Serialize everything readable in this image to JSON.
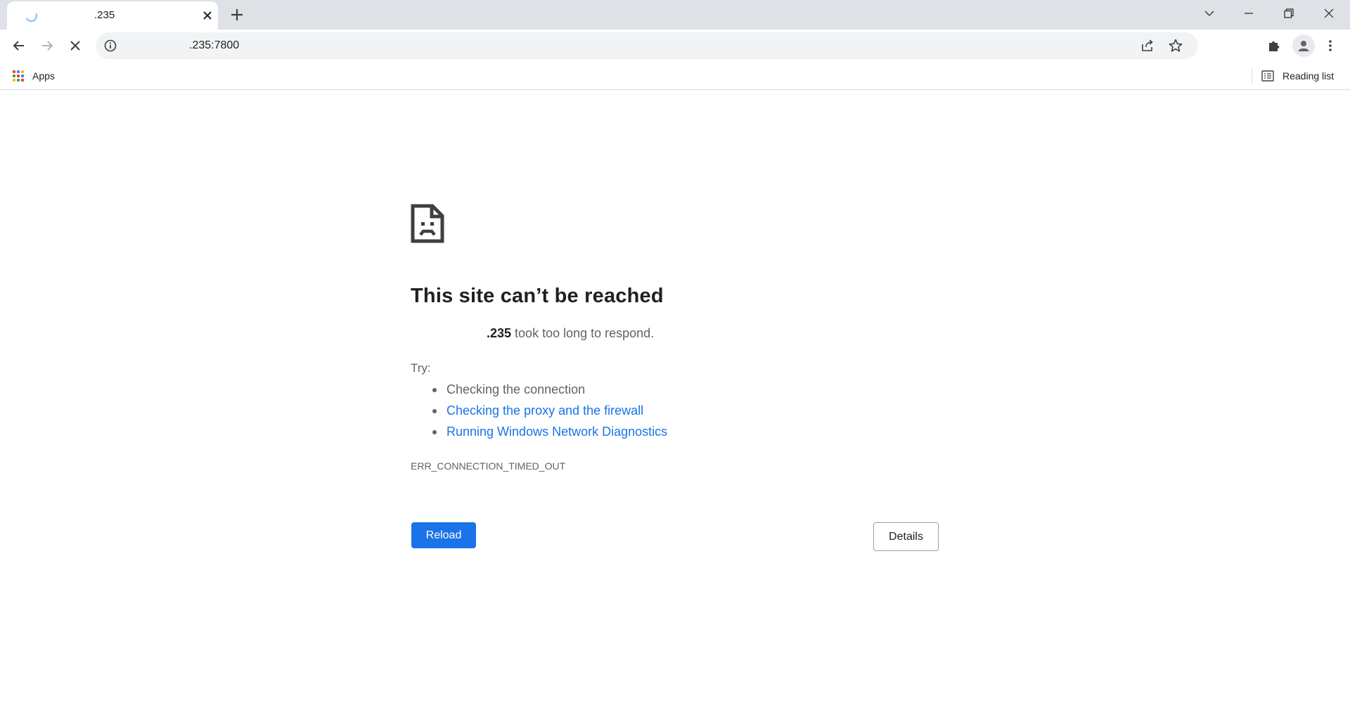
{
  "tab": {
    "title": ".235",
    "close_icon": "close-icon",
    "loading_icon": "spinner-icon"
  },
  "window_controls": [
    "tab-search-icon",
    "minimize-icon",
    "restore-icon",
    "close-icon"
  ],
  "toolbar": {
    "url": ".235:7800",
    "back_icon": "arrow-left-icon",
    "forward_icon": "arrow-right-icon",
    "stop_icon": "close-icon",
    "info_icon": "info-icon",
    "share_icon": "share-icon",
    "star_icon": "star-icon",
    "extensions_icon": "puzzle-icon",
    "profile_icon": "person-icon",
    "menu_icon": "more-vertical-icon"
  },
  "bookmarks": {
    "apps_label": "Apps",
    "reading_list_label": "Reading list"
  },
  "error": {
    "title": "This site can’t be reached",
    "host": ".235",
    "desc_suffix": " took too long to respond.",
    "try_label": "Try:",
    "suggestions": [
      {
        "text": "Checking the connection",
        "link": false
      },
      {
        "text": "Checking the proxy and the firewall",
        "link": true
      },
      {
        "text": "Running Windows Network Diagnostics",
        "link": true
      }
    ],
    "code": "ERR_CONNECTION_TIMED_OUT",
    "reload_label": "Reload",
    "details_label": "Details"
  },
  "colors": {
    "accent": "#1a73e8",
    "tabstrip": "#dee1e6",
    "omnibox": "#f1f3f4",
    "secondary_text": "#5f6368"
  }
}
